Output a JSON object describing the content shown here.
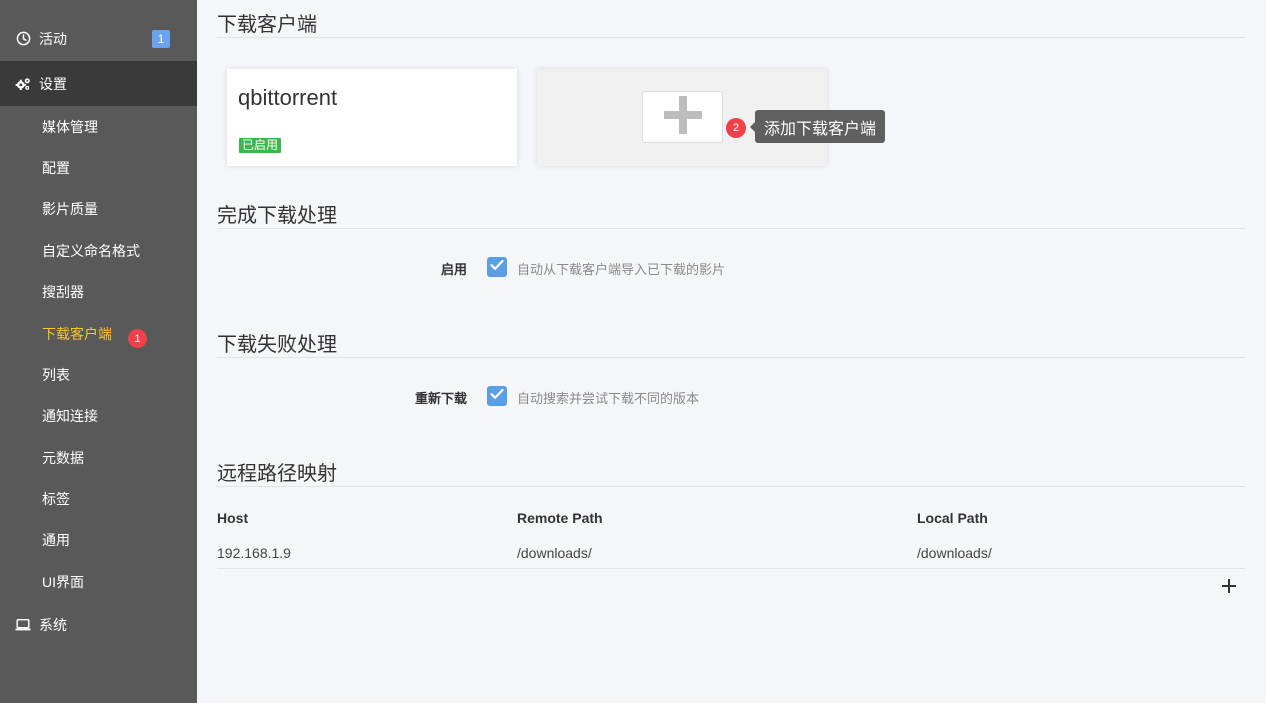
{
  "sidebar": {
    "activity": {
      "label": "活动",
      "badge": "1",
      "icon": "clock-icon"
    },
    "settings": {
      "label": "设置",
      "icon": "gears-icon"
    },
    "sub_items": [
      "媒体管理",
      "配置",
      "影片质量",
      "自定义命名格式",
      "搜刮器",
      "下载客户端",
      "列表",
      "通知连接",
      "元数据",
      "标签",
      "通用",
      "UI界面"
    ],
    "active_item_badge": "1",
    "system": {
      "label": "系统",
      "icon": "laptop-icon"
    }
  },
  "download_clients": {
    "title": "下载客户端",
    "clients": [
      {
        "name": "qbittorrent",
        "status": "已启用"
      }
    ],
    "add_tooltip": "添加下载客户端",
    "tooltip_badge": "2"
  },
  "completed_handling": {
    "title": "完成下载处理",
    "label": "启用",
    "checked": true,
    "description": "自动从下载客户端导入已下载的影片"
  },
  "failed_handling": {
    "title": "下载失败处理",
    "label": "重新下载",
    "checked": true,
    "description": "自动搜索并尝试下载不同的版本"
  },
  "remote_path_mappings": {
    "title": "远程路径映射",
    "columns": [
      "Host",
      "Remote Path",
      "Local Path"
    ],
    "rows": [
      [
        "192.168.1.9",
        "/downloads/",
        "/downloads/"
      ]
    ]
  },
  "colors": {
    "sidebar_bg": "#595959",
    "active_nav_bg": "#3a3a3a",
    "active_sub_item": "#ffc230",
    "badge_red": "#f0414b",
    "badge_blue": "#6aa4ef",
    "enabled_green": "#3cb84a",
    "checkbox_blue": "#5a9ee7"
  }
}
